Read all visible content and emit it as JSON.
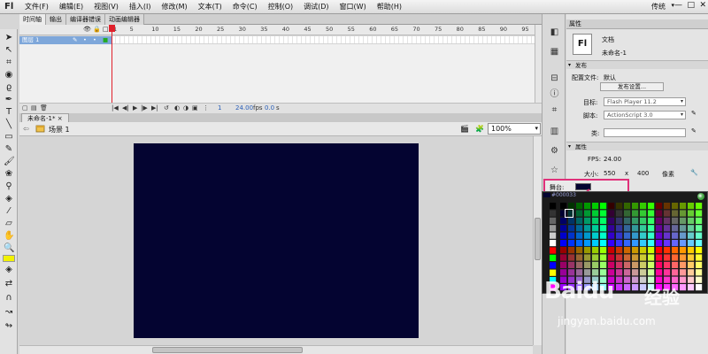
{
  "app": {
    "logo": "Fl",
    "workspace": "传统",
    "window_controls": [
      "—",
      "□",
      "✕"
    ]
  },
  "menu": [
    "文件(F)",
    "编辑(E)",
    "视图(V)",
    "插入(I)",
    "修改(M)",
    "文本(T)",
    "命令(C)",
    "控制(O)",
    "调试(D)",
    "窗口(W)",
    "帮助(H)"
  ],
  "timeline": {
    "tabs": [
      "时间轴",
      "输出",
      "编译器错误",
      "动画编辑器"
    ],
    "frame_numbers": [
      "1",
      "5",
      "10",
      "15",
      "20",
      "25",
      "30",
      "35",
      "40",
      "45",
      "50",
      "55",
      "60",
      "65",
      "70",
      "75",
      "80",
      "85",
      "90",
      "95"
    ],
    "layer_name": "图层 1",
    "current_frame": "1",
    "fps": "24.00",
    "fps_unit": "fps",
    "time": "0.0",
    "time_unit": "s"
  },
  "document": {
    "tab": "未命名-1*",
    "close": "×",
    "scene": "场景 1",
    "zoom": "100%"
  },
  "properties": {
    "panel_title": "属性",
    "doc_type": "文档",
    "doc_icon": "Fl",
    "doc_name": "未命名-1",
    "publish_section": "发布",
    "profile_label": "配置文件:",
    "profile_value": "默认",
    "publish_settings_btn": "发布设置...",
    "target_label": "目标:",
    "target_value": "Flash Player 11.2",
    "script_label": "脚本:",
    "script_value": "ActionScript 3.0",
    "class_label": "类:",
    "class_value": "",
    "attributes_section": "属性",
    "fps_label": "FPS:",
    "fps_value": "24.00",
    "size_label": "大小:",
    "width_value": "550",
    "size_x": "x",
    "height_value": "400",
    "size_unit": "像素",
    "stage_label": "舞台:",
    "stage_color": "#000033"
  },
  "color_picker": {
    "hex": "#000033"
  },
  "watermark": {
    "brand": "Baidu",
    "cn": "经验",
    "url": "jingyan.baidu.com"
  },
  "colors": {
    "stage": "#040431",
    "accent_pink": "#e0317a",
    "layer_highlight": "#7ea7da",
    "playhead": "#e1202b"
  }
}
